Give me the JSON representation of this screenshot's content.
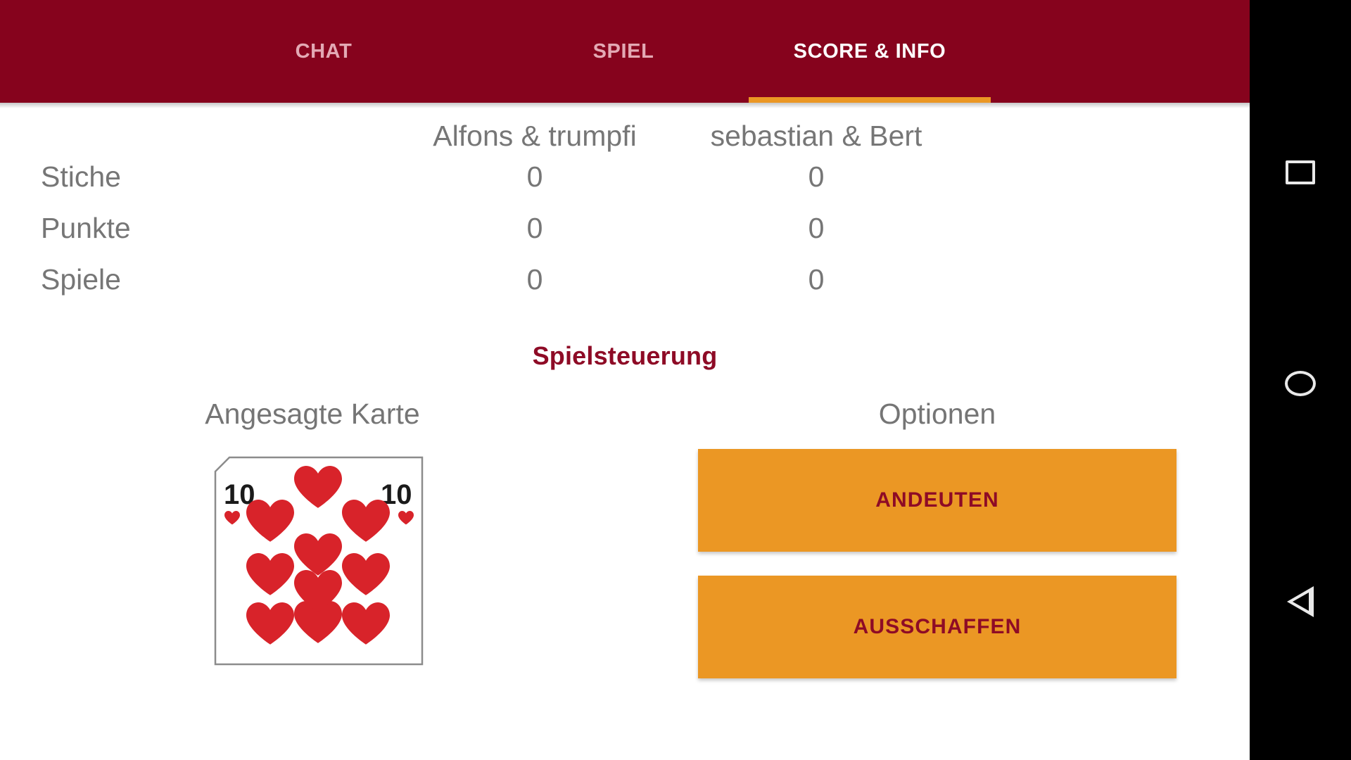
{
  "tabs": [
    {
      "label": "CHAT",
      "active": false
    },
    {
      "label": "SPIEL",
      "active": false
    },
    {
      "label": "SCORE & INFO",
      "active": true
    }
  ],
  "colors": {
    "header_red": "#86031d",
    "accent_orange": "#eb9724",
    "title_red": "#8e0b26",
    "text_gray": "#767676",
    "card_red": "#d8232a",
    "navbar_black": "#000000"
  },
  "score_table": {
    "teams": [
      "Alfons & trumpfi",
      "sebastian & Bert"
    ],
    "rows": [
      {
        "label": "Stiche",
        "values": [
          "0",
          "0"
        ]
      },
      {
        "label": "Punkte",
        "values": [
          "0",
          "0"
        ]
      },
      {
        "label": "Spiele",
        "values": [
          "0",
          "0"
        ]
      }
    ]
  },
  "section": {
    "title": "Spielsteuerung"
  },
  "card_panel": {
    "heading": "Angesagte Karte",
    "card": {
      "rank": "10",
      "suit": "hearts",
      "pip_count": 10
    }
  },
  "options_panel": {
    "heading": "Optionen",
    "buttons": [
      {
        "label": "ANDEUTEN"
      },
      {
        "label": "AUSSCHAFFEN"
      }
    ]
  },
  "navbar": {
    "buttons": [
      {
        "name": "recents",
        "icon": "square-icon"
      },
      {
        "name": "home",
        "icon": "circle-icon"
      },
      {
        "name": "back",
        "icon": "triangle-left-icon"
      }
    ]
  }
}
